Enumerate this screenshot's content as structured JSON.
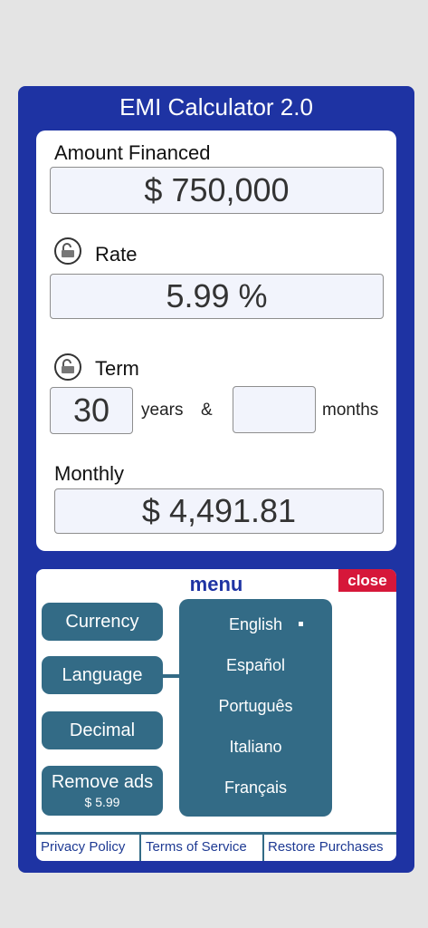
{
  "app": {
    "title": "EMI Calculator 2.0"
  },
  "calculator": {
    "amount_label": "Amount Financed",
    "amount_value": "$ 750,000",
    "rate_label": "Rate",
    "rate_value": "5.99 %",
    "term_label": "Term",
    "term_years_value": "30",
    "term_years_unit": "years",
    "term_and": "&",
    "term_months_value": "",
    "term_months_unit": "months",
    "monthly_label": "Monthly",
    "monthly_value": "$ 4,491.81"
  },
  "menu": {
    "title": "menu",
    "close_label": "close",
    "buttons": [
      {
        "label": "Currency"
      },
      {
        "label": "Language"
      },
      {
        "label": "Decimal"
      },
      {
        "label": "Remove ads",
        "sub": "$ 5.99"
      }
    ],
    "languages": [
      {
        "label": "English",
        "selected": true
      },
      {
        "label": "Español"
      },
      {
        "label": "Português"
      },
      {
        "label": "Italiano"
      },
      {
        "label": "Français"
      }
    ],
    "footer": {
      "privacy": "Privacy Policy",
      "terms": "Terms of Service",
      "restore": "Restore Purchases"
    }
  },
  "colors": {
    "app_background": "#1e33a3",
    "menu_button": "#336b86",
    "close_button": "#d6173a",
    "field_background": "#f2f4fc"
  }
}
